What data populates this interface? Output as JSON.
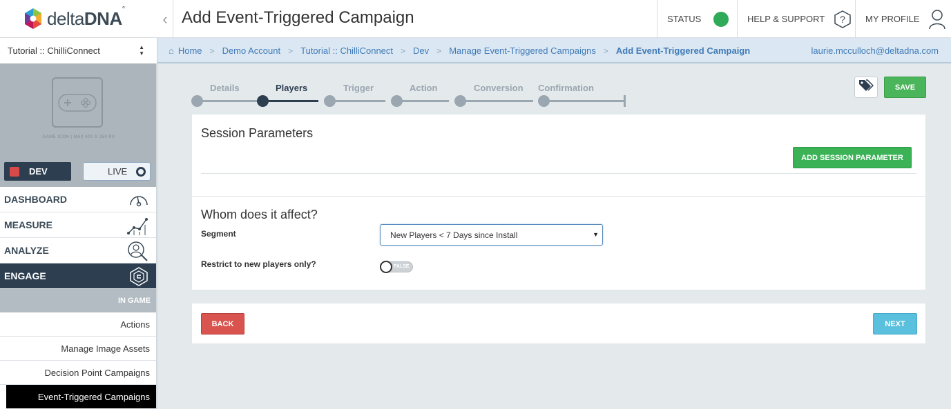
{
  "header": {
    "logo_text_light": "delta",
    "logo_text_bold": "DNA",
    "logo_mark": "°",
    "title": "Add Event-Triggered Campaign",
    "status_label": "STATUS",
    "status_color": "#2eaa59",
    "help_label": "HELP & SUPPORT",
    "profile_label": "MY PROFILE"
  },
  "subbar": {
    "project": "Tutorial :: ChilliConnect",
    "breadcrumb": [
      "Home",
      "Demo Account",
      "Tutorial :: ChilliConnect",
      "Dev",
      "Manage Event-Triggered Campaigns",
      "Add Event-Triggered Campaign"
    ],
    "user_email": "laurie.mcculloch@deltadna.com"
  },
  "sidebar": {
    "game_icon_caption": "GAME ICON  |  MAX 400 X 250 PX",
    "env_dev": "DEV",
    "env_live": "LIVE",
    "nav": [
      "DASHBOARD",
      "MEASURE",
      "ANALYZE",
      "ENGAGE"
    ],
    "section": "IN GAME",
    "sub_items": [
      "Actions",
      "Manage Image Assets",
      "Decision Point Campaigns",
      "Event-Triggered Campaigns"
    ]
  },
  "wizard": {
    "steps": [
      "Details",
      "Players",
      "Trigger",
      "Action",
      "Conversion",
      "Confirmation"
    ],
    "active": "Players"
  },
  "toolbar": {
    "save_label": "SAVE"
  },
  "session": {
    "title": "Session Parameters",
    "add_button": "ADD SESSION PARAMETER"
  },
  "affect": {
    "title": "Whom does it affect?",
    "segment_label": "Segment",
    "segment_value": "New Players < 7 Days since Install",
    "restrict_label": "Restrict to new players only?",
    "restrict_value": "FALSE"
  },
  "footer": {
    "back_label": "BACK",
    "next_label": "NEXT"
  }
}
